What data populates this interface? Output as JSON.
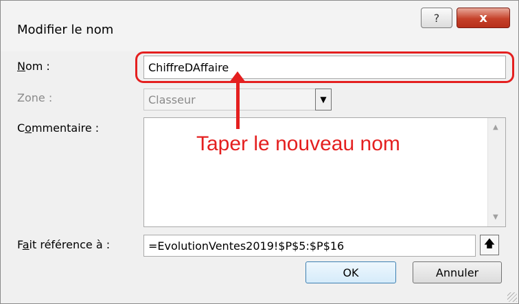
{
  "window": {
    "title": "Modifier le nom",
    "help_icon": "question-mark-icon",
    "help_glyph": "?",
    "close_icon": "close-icon",
    "close_glyph": "x"
  },
  "fields": {
    "nom": {
      "label_prefix": "",
      "label_accel": "N",
      "label_rest": "om :",
      "value": "ChiffreDAffaire"
    },
    "zone": {
      "label": "Zone :",
      "value": "Classeur",
      "dropdown_glyph": "▼"
    },
    "commentaire": {
      "label_prefix": "C",
      "label_accel": "o",
      "label_rest": "mmentaire :",
      "value": ""
    },
    "reference": {
      "label_prefix": "F",
      "label_accel": "a",
      "label_rest": "it référence à :",
      "value": "=EvolutionVentes2019!$P$5:$P$16",
      "button_glyph": "🡅"
    }
  },
  "buttons": {
    "ok": "OK",
    "cancel": "Annuler"
  },
  "annotation": {
    "text": "Taper le nouveau nom",
    "color": "#e41f1f"
  },
  "scroll": {
    "up": "▲",
    "down": "▼"
  }
}
